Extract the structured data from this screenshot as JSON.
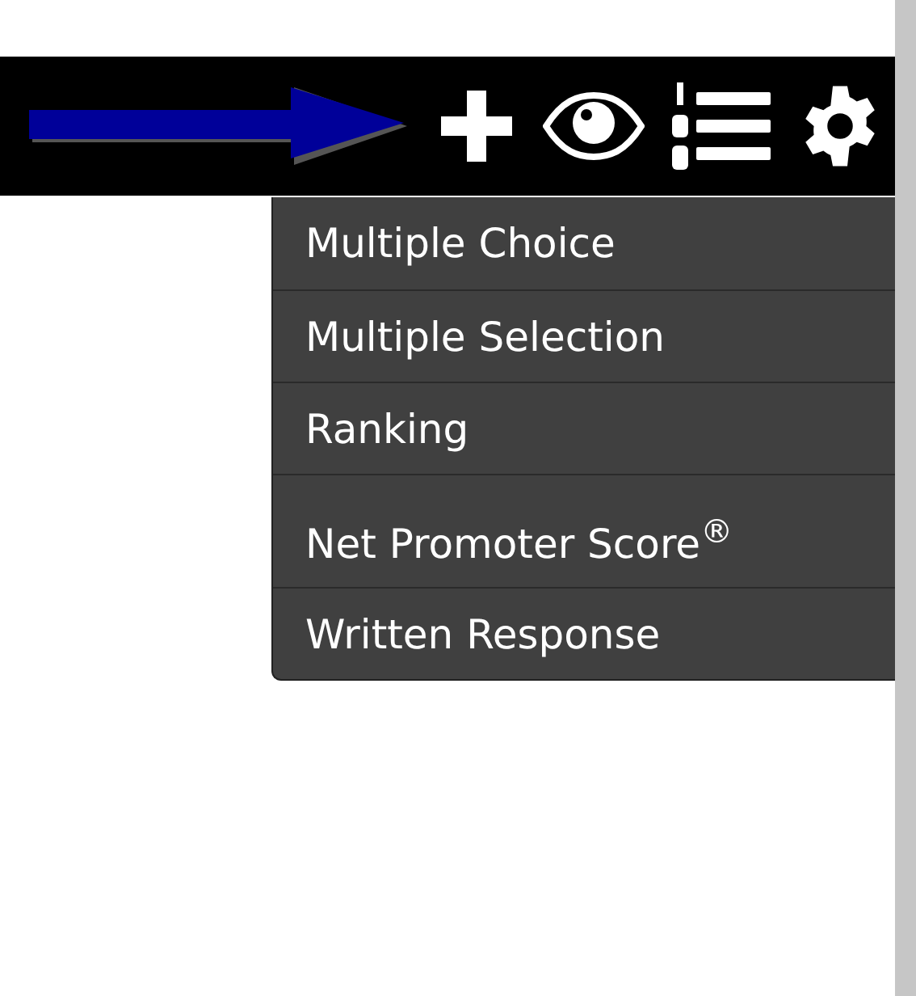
{
  "toolbar": {
    "buttons": [
      {
        "kind": "add"
      },
      {
        "kind": "preview"
      },
      {
        "kind": "order"
      },
      {
        "kind": "settings"
      }
    ]
  },
  "menu": {
    "items": [
      {
        "label": "Multiple Choice"
      },
      {
        "label": "Multiple Selection"
      },
      {
        "label": "Ranking"
      },
      {
        "label": "Net Promoter Score$^{®}$",
        "tall": true
      },
      {
        "label": "Written Response"
      }
    ]
  }
}
